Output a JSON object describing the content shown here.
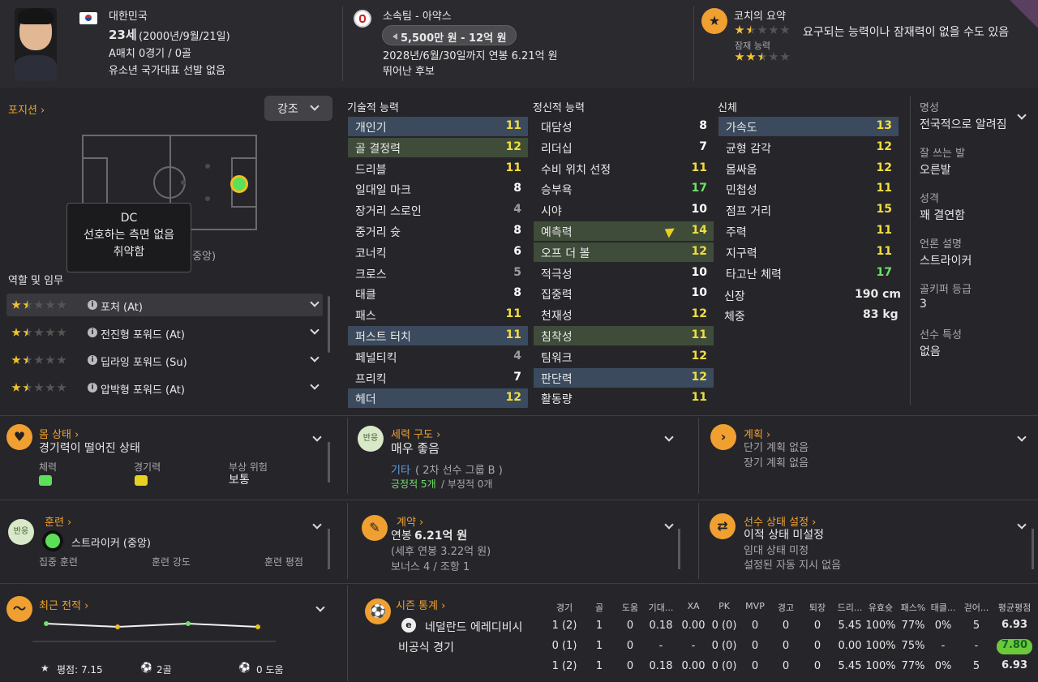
{
  "player": {
    "nation": "대한민국",
    "age": "23세",
    "dob": "(2000년/9월/21일)",
    "caps": "A매치 0경기 / 0골",
    "youth": "유소년 국가대표 선발 없음"
  },
  "club": {
    "label": "소속팀 - 아약스",
    "value": "5,500만 원 - 12억 원",
    "contract": "2028년/6월/30일까지 연봉 6.21억 원",
    "status": "뛰어난 후보"
  },
  "coach": {
    "title": "코치의 요약",
    "note": "요구되는 능력이나 잠재력이 없을 수도 있음",
    "potential_label": "잠재 능력",
    "current_stars": 1.5,
    "potential_stars": 2.5
  },
  "position": {
    "title": "포지션",
    "highlight_btn": "강조",
    "tooltip": [
      "DC",
      "선호하는 측면 없음",
      "취약함"
    ],
    "pitch_label": "(중앙)"
  },
  "roles": {
    "title": "역할 및 임무",
    "items": [
      {
        "name": "포처 (At)",
        "stars": 1.5
      },
      {
        "name": "전진형 포워드 (At)",
        "stars": 1.5
      },
      {
        "name": "딥라잉 포워드 (Su)",
        "stars": 1.5
      },
      {
        "name": "압박형 포워드 (At)",
        "stars": 1.5
      }
    ]
  },
  "technical": {
    "title": "기술적 능력",
    "items": [
      {
        "name": "개인기",
        "value": "11",
        "hl": "b",
        "c": "y"
      },
      {
        "name": "골 결정력",
        "value": "12",
        "hl": "g",
        "c": "y"
      },
      {
        "name": "드리블",
        "value": "11",
        "hl": "",
        "c": "y"
      },
      {
        "name": "일대일 마크",
        "value": "8",
        "hl": "",
        "c": "w"
      },
      {
        "name": "장거리 스로인",
        "value": "4",
        "hl": "",
        "c": "gr"
      },
      {
        "name": "중거리 슛",
        "value": "8",
        "hl": "",
        "c": "w"
      },
      {
        "name": "코너킥",
        "value": "6",
        "hl": "",
        "c": "w"
      },
      {
        "name": "크로스",
        "value": "5",
        "hl": "",
        "c": "gr"
      },
      {
        "name": "태클",
        "value": "8",
        "hl": "",
        "c": "w"
      },
      {
        "name": "패스",
        "value": "11",
        "hl": "",
        "c": "y"
      },
      {
        "name": "퍼스트 터치",
        "value": "11",
        "hl": "b",
        "c": "y"
      },
      {
        "name": "페널티킥",
        "value": "4",
        "hl": "",
        "c": "gr"
      },
      {
        "name": "프리킥",
        "value": "7",
        "hl": "",
        "c": "w"
      },
      {
        "name": "헤더",
        "value": "12",
        "hl": "b",
        "c": "y"
      }
    ]
  },
  "mental": {
    "title": "정신적 능력",
    "items": [
      {
        "name": "대담성",
        "value": "8",
        "hl": "",
        "c": "w"
      },
      {
        "name": "리더십",
        "value": "7",
        "hl": "",
        "c": "w"
      },
      {
        "name": "수비 위치 선정",
        "value": "11",
        "hl": "",
        "c": "y"
      },
      {
        "name": "승부욕",
        "value": "17",
        "hl": "",
        "c": "g"
      },
      {
        "name": "시야",
        "value": "10",
        "hl": "",
        "c": "w"
      },
      {
        "name": "예측력",
        "value": "14",
        "hl": "g",
        "c": "y"
      },
      {
        "name": "오프 더 볼",
        "value": "12",
        "hl": "g",
        "c": "y"
      },
      {
        "name": "적극성",
        "value": "10",
        "hl": "",
        "c": "w"
      },
      {
        "name": "집중력",
        "value": "10",
        "hl": "",
        "c": "w"
      },
      {
        "name": "천재성",
        "value": "12",
        "hl": "",
        "c": "y"
      },
      {
        "name": "침착성",
        "value": "11",
        "hl": "g",
        "c": "y"
      },
      {
        "name": "팀워크",
        "value": "12",
        "hl": "",
        "c": "y"
      },
      {
        "name": "판단력",
        "value": "12",
        "hl": "b",
        "c": "y"
      },
      {
        "name": "활동량",
        "value": "11",
        "hl": "",
        "c": "y"
      }
    ]
  },
  "physical": {
    "title": "신체",
    "items": [
      {
        "name": "가속도",
        "value": "13",
        "hl": "b",
        "c": "y"
      },
      {
        "name": "균형 감각",
        "value": "12",
        "hl": "",
        "c": "y"
      },
      {
        "name": "몸싸움",
        "value": "12",
        "hl": "",
        "c": "y"
      },
      {
        "name": "민첩성",
        "value": "11",
        "hl": "",
        "c": "y"
      },
      {
        "name": "점프 거리",
        "value": "15",
        "hl": "",
        "c": "y"
      },
      {
        "name": "주력",
        "value": "11",
        "hl": "",
        "c": "y"
      },
      {
        "name": "지구력",
        "value": "11",
        "hl": "",
        "c": "y"
      },
      {
        "name": "타고난 체력",
        "value": "17",
        "hl": "",
        "c": "g"
      }
    ],
    "height_label": "신장",
    "height": "190 cm",
    "weight_label": "체중",
    "weight": "83 kg"
  },
  "info": [
    {
      "k": "명성",
      "v": "전국적으로 알려짐"
    },
    {
      "k": "잘 쓰는 발",
      "v": "오른발"
    },
    {
      "k": "성격",
      "v": "꽤 결연함"
    },
    {
      "k": "언론 설명",
      "v": "스트라이커"
    },
    {
      "k": "골키퍼 등급",
      "v": "3"
    },
    {
      "k": "선수 특성",
      "v": "없음"
    }
  ],
  "fitness": {
    "title": "몸 상태",
    "value": "경기력이 떨어진 상태",
    "c1": "체력",
    "c2": "경기력",
    "c3": "부상 위험",
    "c3v": "보통"
  },
  "dynamics": {
    "badge": "반응",
    "title": "세력 구도",
    "value": "매우 좋음",
    "group_link": "기타",
    "group_rest": "( 2차 선수 그룹 B )",
    "positive": "긍정적 5개",
    "negative": "/ 부정적 0개"
  },
  "plans": {
    "title": "계획",
    "l1": "단기 계획 없음",
    "l2": "장기 계획 없음"
  },
  "training": {
    "badge": "반응",
    "title": "훈련",
    "role": "스트라이커 (중앙)",
    "c1": "집중 훈련",
    "c2": "훈련 강도",
    "c3": "훈련 평점"
  },
  "contract": {
    "title": "계약",
    "wage_pre": "연봉",
    "wage": "6.21억 원",
    "aftertax": "(세후 연봉 3.22억 원)",
    "bonus": "보너스 4 / 조항 1"
  },
  "status": {
    "title": "선수 상태 설정",
    "value": "이적 상태 미설정",
    "l1": "임대 상태 미정",
    "l2": "설정된 자동 지시 없음"
  },
  "form": {
    "title": "최근 전적",
    "rating": "평점: 7.15",
    "goals": "2골",
    "assists": "0 도움",
    "points": [
      7.2,
      7.0,
      7.2,
      7.0
    ]
  },
  "season": {
    "title": "시즌 통계",
    "headers": [
      "경기",
      "골",
      "도움",
      "기대...",
      "XA",
      "PK",
      "MVP",
      "경고",
      "퇴장",
      "드리...",
      "유효슛",
      "패스%",
      "태클...",
      "걷어...",
      "평균평점"
    ],
    "rows": [
      {
        "name": "네덜란드 에레디비시",
        "cells": [
          "1 (2)",
          "1",
          "0",
          "0.18",
          "0.00",
          "0 (0)",
          "0",
          "0",
          "0",
          "5.45",
          "100%",
          "77%",
          "0%",
          "5"
        ],
        "rating": "6.93",
        "green": false
      },
      {
        "name": "비공식 경기",
        "cells": [
          "0 (1)",
          "1",
          "0",
          "-",
          "-",
          "0 (0)",
          "0",
          "0",
          "0",
          "0.00",
          "100%",
          "75%",
          "-",
          "-"
        ],
        "rating": "7.80",
        "green": true
      },
      {
        "name": "",
        "cells": [
          "1 (2)",
          "1",
          "0",
          "0.18",
          "0.00",
          "0 (0)",
          "0",
          "0",
          "0",
          "5.45",
          "100%",
          "77%",
          "0%",
          "5"
        ],
        "rating": "6.93",
        "green": false
      }
    ]
  }
}
